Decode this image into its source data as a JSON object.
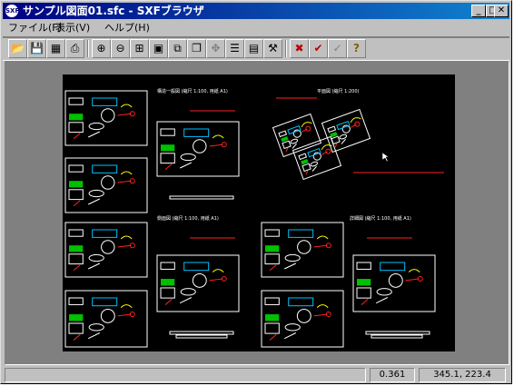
{
  "window": {
    "title": "サンプル図面01.sfc - SXFブラウザ",
    "app_icon": "SXF",
    "controls": {
      "minimize": "_",
      "maximize": "□",
      "close": "✕"
    }
  },
  "menu": [
    "ファイル(F)",
    "表示(V)",
    "ヘルプ(H)"
  ],
  "toolbar": {
    "buttons": [
      {
        "icon": "open-folder-icon",
        "glyph": "📂"
      },
      {
        "icon": "save-icon",
        "glyph": "💾"
      },
      {
        "icon": "print-preview-icon",
        "glyph": "▦"
      },
      {
        "icon": "print-icon",
        "glyph": "⎙"
      },
      {
        "icon": "zoom-in-icon",
        "glyph": "⊕"
      },
      {
        "icon": "zoom-out-icon",
        "glyph": "⊖"
      },
      {
        "icon": "zoom-window-icon",
        "glyph": "⊞"
      },
      {
        "icon": "fit-page-icon",
        "glyph": "▣"
      },
      {
        "icon": "zoom-previous-icon",
        "glyph": "⧉"
      },
      {
        "icon": "redraw-icon",
        "glyph": "❐"
      },
      {
        "icon": "pan-icon",
        "glyph": "✥"
      },
      {
        "icon": "layer-icon",
        "glyph": "☰"
      },
      {
        "icon": "attribute-icon",
        "glyph": "▤"
      },
      {
        "icon": "hammer-icon",
        "glyph": "⚒"
      },
      {
        "icon": "check-error-icon",
        "glyph": "✖"
      },
      {
        "icon": "checkmark-icon",
        "glyph": "✔"
      },
      {
        "icon": "check-list-icon",
        "glyph": "✓"
      },
      {
        "icon": "help-icon",
        "glyph": "?"
      }
    ]
  },
  "drawing": {
    "sheet_labels": [
      "構造一般図 (縮尺 1:100, 用紙 A1)",
      "平面図 (縮尺 1:200)",
      "側面図 (縮尺 1:100, 用紙 A1)",
      "詳細図 (縮尺 1:100, 用紙 A1)"
    ]
  },
  "status": {
    "ready": "",
    "scale": "0.361",
    "coordinates": "345.1,  223.4"
  },
  "colors": {
    "title_start": "#000080",
    "title_end": "#1084d0",
    "face": "#c0c0c0",
    "canvas": "#808080"
  }
}
